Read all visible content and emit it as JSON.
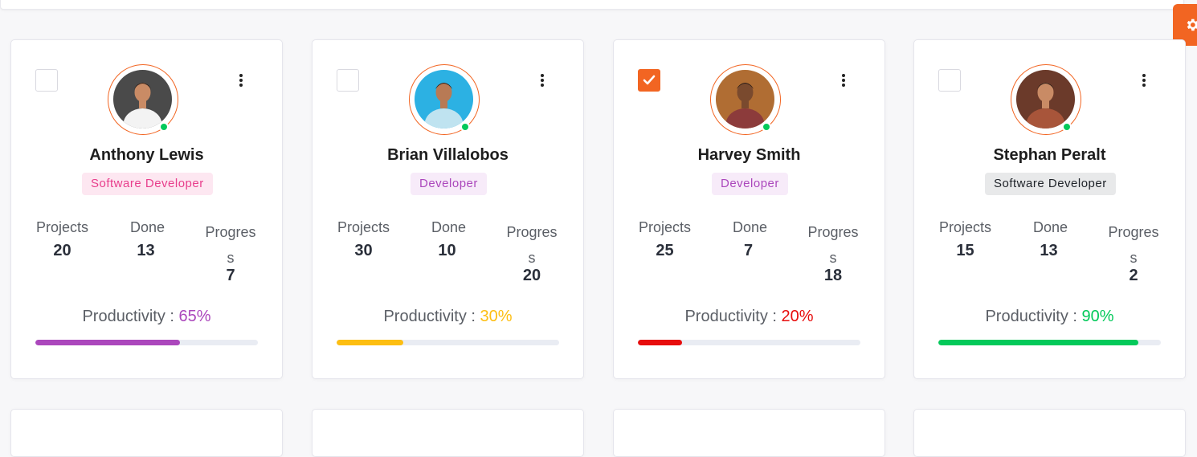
{
  "colors": {
    "accent": "#f26522",
    "online": "#03c95a"
  },
  "icons": {
    "settings": "gear-icon",
    "menu": "more-vertical-icon",
    "check": "check-icon"
  },
  "stats_labels": {
    "projects": "Projects",
    "done": "Done",
    "progress_line1": "Progres",
    "progress_line2": "s"
  },
  "productivity_label": "Productivity : ",
  "employees": [
    {
      "name": "Anthony Lewis",
      "role": "Software Developer",
      "role_bg": "#fde7f1",
      "role_color": "#e83e8c",
      "checked": false,
      "projects": "20",
      "done": "13",
      "progress": "7",
      "productivity": "65%",
      "productivity_value": 0.65,
      "productivity_color": "#ab47bc",
      "avatar_bg": "#4a4a4a",
      "avatar_shirt": "#f3f3f3",
      "avatar_skin": "#c98b65"
    },
    {
      "name": "Brian Villalobos",
      "role": "Developer",
      "role_bg": "#f7ebf9",
      "role_color": "#ab47bc",
      "checked": false,
      "projects": "30",
      "done": "10",
      "progress": "20",
      "productivity": "30%",
      "productivity_value": 0.3,
      "productivity_color": "#fdbe12",
      "avatar_bg": "#2cb1e3",
      "avatar_shirt": "#bfe3f0",
      "avatar_skin": "#b87a55"
    },
    {
      "name": "Harvey Smith",
      "role": "Developer",
      "role_bg": "#f7ebf9",
      "role_color": "#ab47bc",
      "checked": true,
      "projects": "25",
      "done": "7",
      "progress": "18",
      "productivity": "20%",
      "productivity_value": 0.2,
      "productivity_color": "#e70d0d",
      "avatar_bg": "#b06d33",
      "avatar_shirt": "#8c3b3b",
      "avatar_skin": "#7a4a2e"
    },
    {
      "name": "Stephan Peralt",
      "role": "Software Developer",
      "role_bg": "#e8e9ea",
      "role_color": "#1f2329",
      "checked": false,
      "projects": "15",
      "done": "13",
      "progress": "2",
      "productivity": "90%",
      "productivity_value": 0.9,
      "productivity_color": "#03c95a",
      "avatar_bg": "#6b3a2a",
      "avatar_shirt": "#a8553a",
      "avatar_skin": "#c98b65"
    }
  ]
}
